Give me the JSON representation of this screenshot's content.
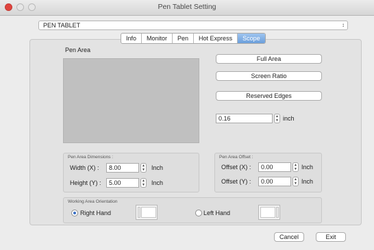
{
  "window": {
    "title": "Pen Tablet Setting"
  },
  "device": {
    "selected": "PEN TABLET",
    "arrows": "↕"
  },
  "tabs": [
    {
      "label": "Info",
      "active": false
    },
    {
      "label": "Monitor",
      "active": false
    },
    {
      "label": "Pen",
      "active": false
    },
    {
      "label": "Hot Express",
      "active": false
    },
    {
      "label": "Scope",
      "active": true
    }
  ],
  "pen_area": {
    "label": "Pen Area"
  },
  "buttons": {
    "full_area": "Full Area",
    "screen_ratio": "Screen Ratio",
    "reserved_edges": "Reserved Edges",
    "cancel": "Cancel",
    "exit": "Exit"
  },
  "edge": {
    "value": "0.16",
    "unit": "inch"
  },
  "dimensions": {
    "title": "Pen Area Dimensions :",
    "width_label": "Width  (X) :",
    "width_value": "8.00",
    "height_label": "Height (Y) :",
    "height_value": "5.00",
    "unit": "Inch"
  },
  "offset": {
    "title": "Pen Area Offset :",
    "x_label": "Offset (X) :",
    "x_value": "0.00",
    "y_label": "Offset (Y) :",
    "y_value": "0.00",
    "unit": "Inch"
  },
  "orientation": {
    "title": "Working Area Orientation",
    "right_hand": "Right Hand",
    "left_hand": "Left Hand",
    "selected": "right"
  },
  "colors": {
    "close": "#e0443e",
    "active_tab": "#6b9fdc",
    "pen_area": "#c0c0c0"
  }
}
